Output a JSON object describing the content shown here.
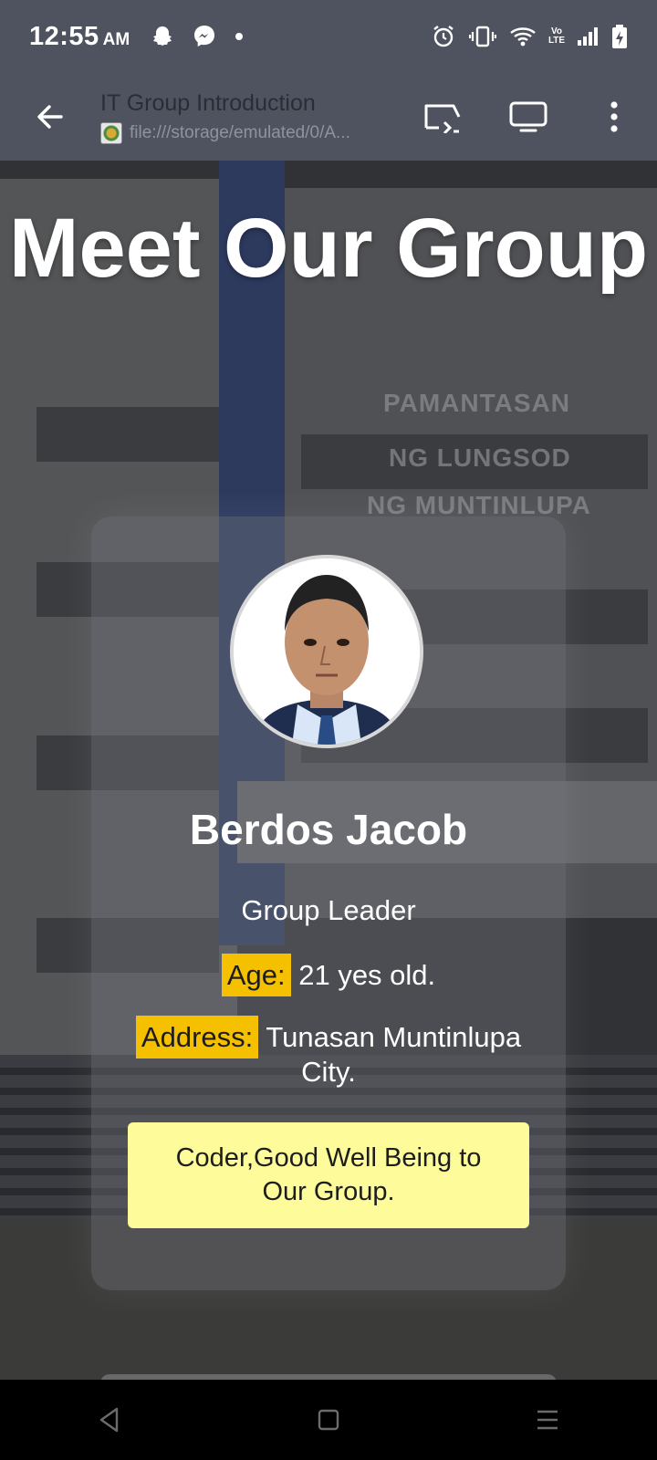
{
  "status_bar": {
    "time": "12:55",
    "ampm": "AM",
    "left_icons": [
      "snapchat-icon",
      "messenger-icon",
      "dot-icon"
    ],
    "right_icons": [
      "alarm-icon",
      "vibrate-icon",
      "wifi-icon",
      "volte-icon",
      "signal-icon",
      "battery-charging-icon"
    ],
    "volte_text": "Vo LTE"
  },
  "toolbar": {
    "title": "IT Group Introduction",
    "url": "file:///storage/emulated/0/A...",
    "icons": [
      "back-arrow-icon",
      "cast-icon",
      "desktop-view-icon",
      "more-vert-icon"
    ]
  },
  "page": {
    "heading": "Meet Our Group",
    "background_sign": [
      "PAMANTASAN",
      "NG LUNGSOD",
      "NG MUNTINLUPA"
    ],
    "card": {
      "name": "Berdos Jacob",
      "role": "Group Leader",
      "age_label": "Age:",
      "age_value": " 21 yes old.",
      "address_label": "Address:",
      "address_value": " Tunasan Muntinlupa City.",
      "note": "Coder,Good Well Being to Our Group."
    }
  },
  "nav_bar": {
    "icons": [
      "nav-back-icon",
      "nav-home-icon",
      "nav-recents-icon"
    ]
  },
  "colors": {
    "bar_bg": "#4f535f",
    "label_highlight": "#f5c000",
    "note_bg": "#fdfb9a"
  }
}
